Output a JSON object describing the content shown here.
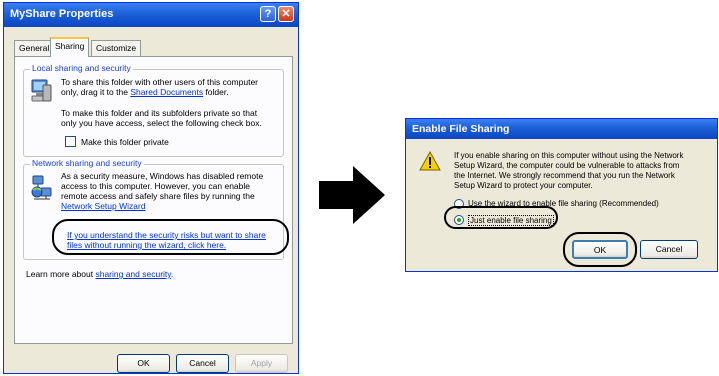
{
  "left_dialog": {
    "title": "MyShare Properties",
    "help_label": "?",
    "close_label": "✕",
    "tabs": [
      {
        "label": "General"
      },
      {
        "label": "Sharing"
      },
      {
        "label": "Customize"
      }
    ],
    "local_group": {
      "heading": "Local sharing and security",
      "line1": "To share this folder with other users of this computer",
      "line2_pre": "only, drag it to the ",
      "line2_link": "Shared Documents",
      "line2_post": " folder.",
      "private_line1": "To make this folder and its subfolders private so that",
      "private_line2": "only you have access, select the following check box.",
      "checkbox_label": "Make this folder private"
    },
    "network_group": {
      "heading": "Network sharing and security",
      "line1": "As a security measure, Windows has disabled remote",
      "line2": "access to this computer. However, you can enable",
      "line3": "remote access and safely share files by running the",
      "wizard_link": "Network Setup Wizard",
      "risk_link_line1": "If you understand the security risks but want to share",
      "risk_link_line2": "files without running the wizard, click here."
    },
    "learn_pre": "Learn more about ",
    "learn_link": "sharing and security",
    "learn_post": ".",
    "buttons": {
      "ok": "OK",
      "cancel": "Cancel",
      "apply": "Apply"
    }
  },
  "right_dialog": {
    "title": "Enable File Sharing",
    "msg_line1": "If you enable sharing on this computer without using the Network",
    "msg_line2": "Setup Wizard, the computer could be vulnerable to attacks from",
    "msg_line3": "the Internet. We strongly recommend that you run the Network",
    "msg_line4": "Setup Wizard to protect your computer.",
    "option1": "Use the wizard to enable file sharing (Recommended)",
    "option2": "Just enable file sharing",
    "buttons": {
      "ok": "OK",
      "cancel": "Cancel"
    }
  },
  "colors": {
    "titlebar_blue": "#0a46c4",
    "highlight_ring": "#000000",
    "warning_yellow": "#f5d000",
    "arrow": "#000000"
  }
}
